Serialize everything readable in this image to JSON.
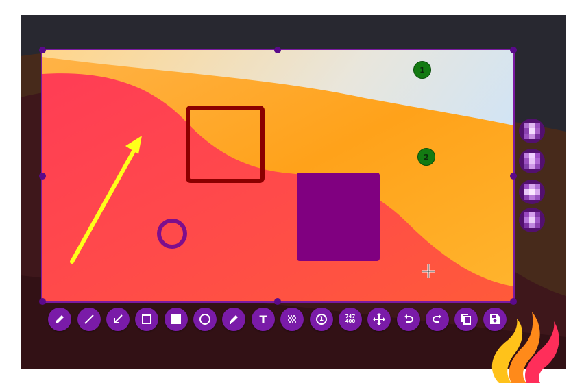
{
  "colors": {
    "selection_border": "#7a1aa0",
    "toolbar_button": "#7a1ba8",
    "rect_outline": "#8b0000",
    "filled_rect": "#800080",
    "circle": "#7e0e8c",
    "arrow": "#ffff1a",
    "marker": "#137a12"
  },
  "markers": [
    {
      "label": "1"
    },
    {
      "label": "2"
    }
  ],
  "toolbar": {
    "tools": [
      {
        "name": "pen-tool",
        "icon": "pencil-icon"
      },
      {
        "name": "line-tool",
        "icon": "line-icon"
      },
      {
        "name": "arrow-tool",
        "icon": "arrow-icon"
      },
      {
        "name": "rectangle-tool",
        "icon": "square-outline-icon"
      },
      {
        "name": "filled-rectangle-tool",
        "icon": "square-filled-icon"
      },
      {
        "name": "circle-tool",
        "icon": "circle-icon"
      },
      {
        "name": "marker-tool",
        "icon": "marker-icon"
      },
      {
        "name": "text-tool",
        "icon": "text-icon",
        "label": "T"
      },
      {
        "name": "pixelate-tool",
        "icon": "pixelate-icon"
      },
      {
        "name": "circle-count-tool",
        "icon": "counter-icon",
        "label": "1"
      },
      {
        "name": "size-indicator",
        "icon": "size-icon",
        "width": "747",
        "height": "400"
      },
      {
        "name": "move-selection-tool",
        "icon": "move-icon"
      },
      {
        "name": "undo-button",
        "icon": "undo-icon"
      },
      {
        "name": "redo-button",
        "icon": "redo-icon"
      },
      {
        "name": "copy-clipboard-button",
        "icon": "copy-icon"
      },
      {
        "name": "save-button",
        "icon": "save-icon"
      }
    ]
  },
  "side_panel": {
    "buttons": [
      {
        "icon": "pixelate-icon"
      },
      {
        "icon": "pixelate-icon"
      },
      {
        "icon": "pixelate-icon"
      },
      {
        "icon": "pixelate-icon"
      }
    ]
  }
}
